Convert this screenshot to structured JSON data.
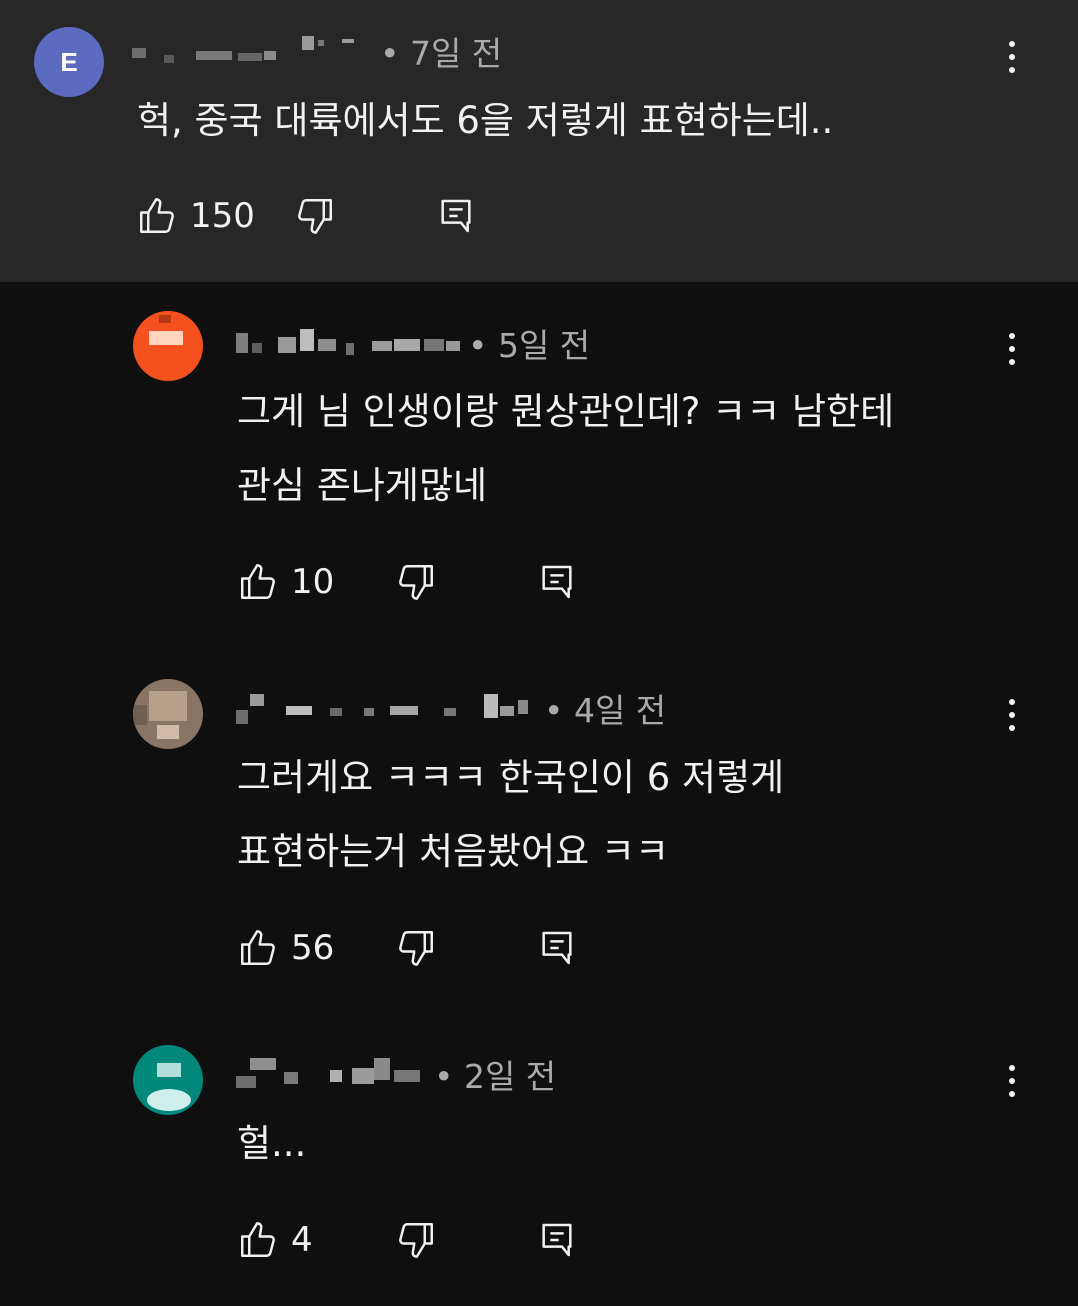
{
  "comments": [
    {
      "time": "• 7일 전",
      "text": "헉, 중국 대륙에서도 6을 저렇게 표현하는데..",
      "likes": "150",
      "avatar_letter": "E",
      "avatar_color": "#5c6bc0"
    },
    {
      "time": "• 5일 전",
      "text": "그게 님 인생이랑 뭔상관인데? ㅋㅋ 남한테\n관심 존나게많네",
      "likes": "10",
      "avatar_color": "#f4511e"
    },
    {
      "time": "• 4일 전",
      "text": "그러게요 ㅋㅋㅋ 한국인이 6 저렇게\n표현하는거 처음봤어요 ㅋㅋ",
      "likes": "56",
      "avatar_color": "#a78b74"
    },
    {
      "time": "• 2일 전",
      "text": "헐...",
      "likes": "4",
      "avatar_color": "#00897b"
    }
  ],
  "icons": {
    "like": "thumb-up-icon",
    "dislike": "thumb-down-icon",
    "reply": "reply-comment-icon",
    "more": "more-vert-icon"
  },
  "colors": {
    "parent_background": "#272727",
    "reply_background": "#0f0f0f",
    "text": "#f1f1f1",
    "secondary_text": "#aaaaaa"
  }
}
